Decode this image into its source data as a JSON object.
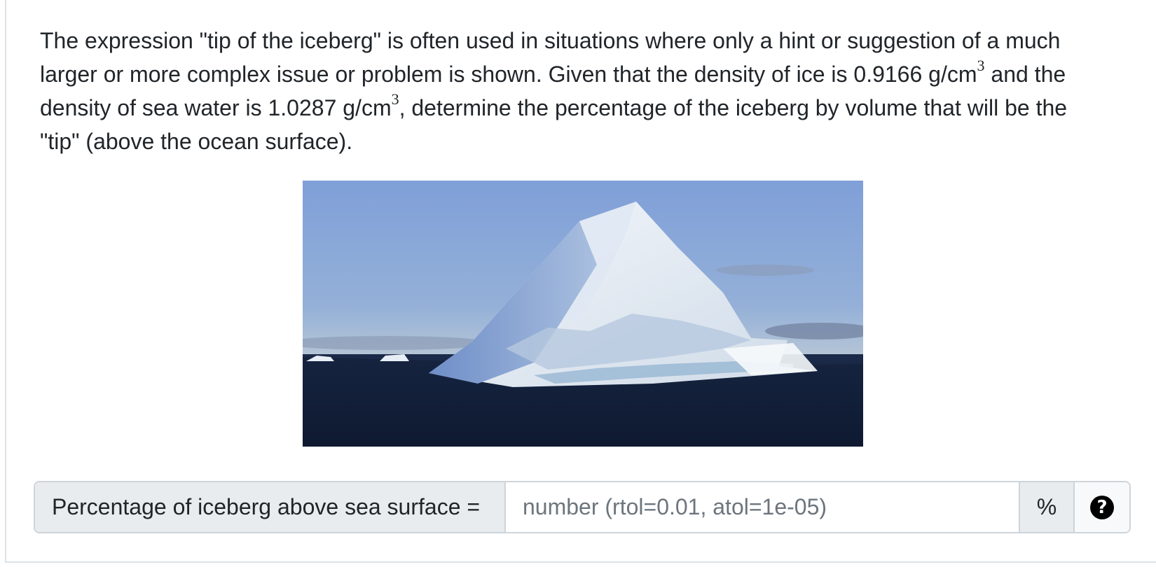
{
  "question": {
    "part1": "The expression \"tip of the iceberg\" is often used in situations where only a hint or suggestion of a much larger or more complex issue or problem is shown. Given that the density of ice is 0.9166 g/cm",
    "sup1": "3",
    "part2": " and the density of sea water is 1.0287 g/cm",
    "sup2": "3",
    "part3": ", determine the percentage of the iceberg by volume that will be the \"tip\" (above the ocean surface)."
  },
  "figure": {
    "subject": "iceberg photo"
  },
  "answer": {
    "label": "Percentage of iceberg above sea surface =",
    "placeholder": "number (rtol=0.01, atol=1e-05)",
    "value": "",
    "unit": "%",
    "help_icon": "question-circle-icon",
    "help_glyph": "?"
  }
}
